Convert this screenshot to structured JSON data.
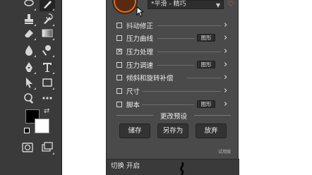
{
  "panel": {
    "preset_value": "*平滑 - 精巧",
    "rows": [
      {
        "label": "抖动修正",
        "checked": false,
        "has_graph": false
      },
      {
        "label": "压力曲线",
        "checked": false,
        "has_graph": true
      },
      {
        "label": "压力处理",
        "checked": true,
        "has_graph": false
      },
      {
        "label": "压力调速",
        "checked": false,
        "has_graph": true
      },
      {
        "label": "倾斜和旋转补偿",
        "checked": false,
        "has_graph": false
      },
      {
        "label": "尺寸",
        "checked": false,
        "has_graph": false
      },
      {
        "label": "脚本",
        "checked": false,
        "has_graph": true
      }
    ],
    "graph_label": "图形",
    "section_title": "更改预设",
    "buttons": {
      "save": "储存",
      "save_as": "另存为",
      "discard": "放弃"
    },
    "trial_label": "试用版",
    "status_text": "切换 开启",
    "accent_color": "#e46a1a"
  },
  "toolbar": {
    "tools": [
      "lasso-icon",
      "brush-icon",
      "stamp-icon",
      "history-brush-icon",
      "eraser-icon",
      "gradient-icon",
      "blur-icon",
      "dodge-icon",
      "pen-icon",
      "type-icon",
      "path-select-icon",
      "shape-icon",
      "zoom-icon",
      "more-icon",
      "quick-mask-icon",
      "screen-mode-icon"
    ],
    "foreground_color": "#000000",
    "background_color": "#ffffff"
  }
}
